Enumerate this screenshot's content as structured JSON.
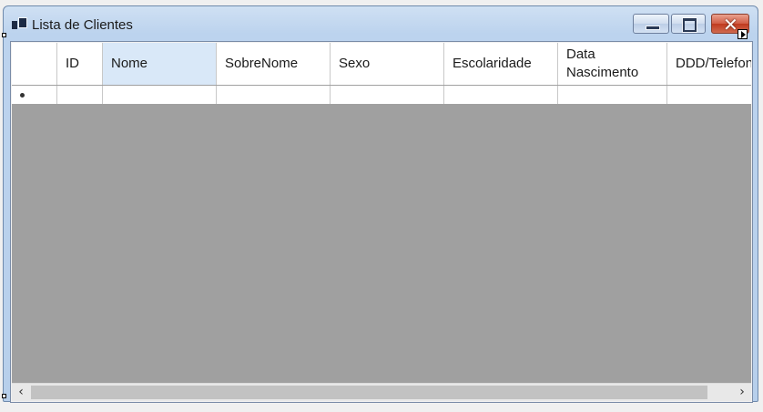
{
  "window": {
    "title": "Lista de Clientes",
    "controls": {
      "minimize": "minimize",
      "maximize": "maximize",
      "close": "close"
    }
  },
  "grid": {
    "columns": [
      {
        "key": "row-header",
        "label": ""
      },
      {
        "key": "id",
        "label": "ID"
      },
      {
        "key": "nome",
        "label": "Nome",
        "selected": true
      },
      {
        "key": "sobrenome",
        "label": "SobreNome"
      },
      {
        "key": "sexo",
        "label": "Sexo"
      },
      {
        "key": "escolaridade",
        "label": "Escolaridade"
      },
      {
        "key": "data-nascimento",
        "label": "Data Nascimento"
      },
      {
        "key": "ddd-telefone",
        "label": "DDD/Telefone"
      }
    ],
    "new_row_marker": "new-row-asterisk-icon"
  },
  "scrollbar": {
    "left_arrow": "‹",
    "right_arrow": "›"
  },
  "colors": {
    "grid_background": "#a0a0a0",
    "selected_header": "#d9e8f8",
    "close_button": "#c0391e"
  }
}
